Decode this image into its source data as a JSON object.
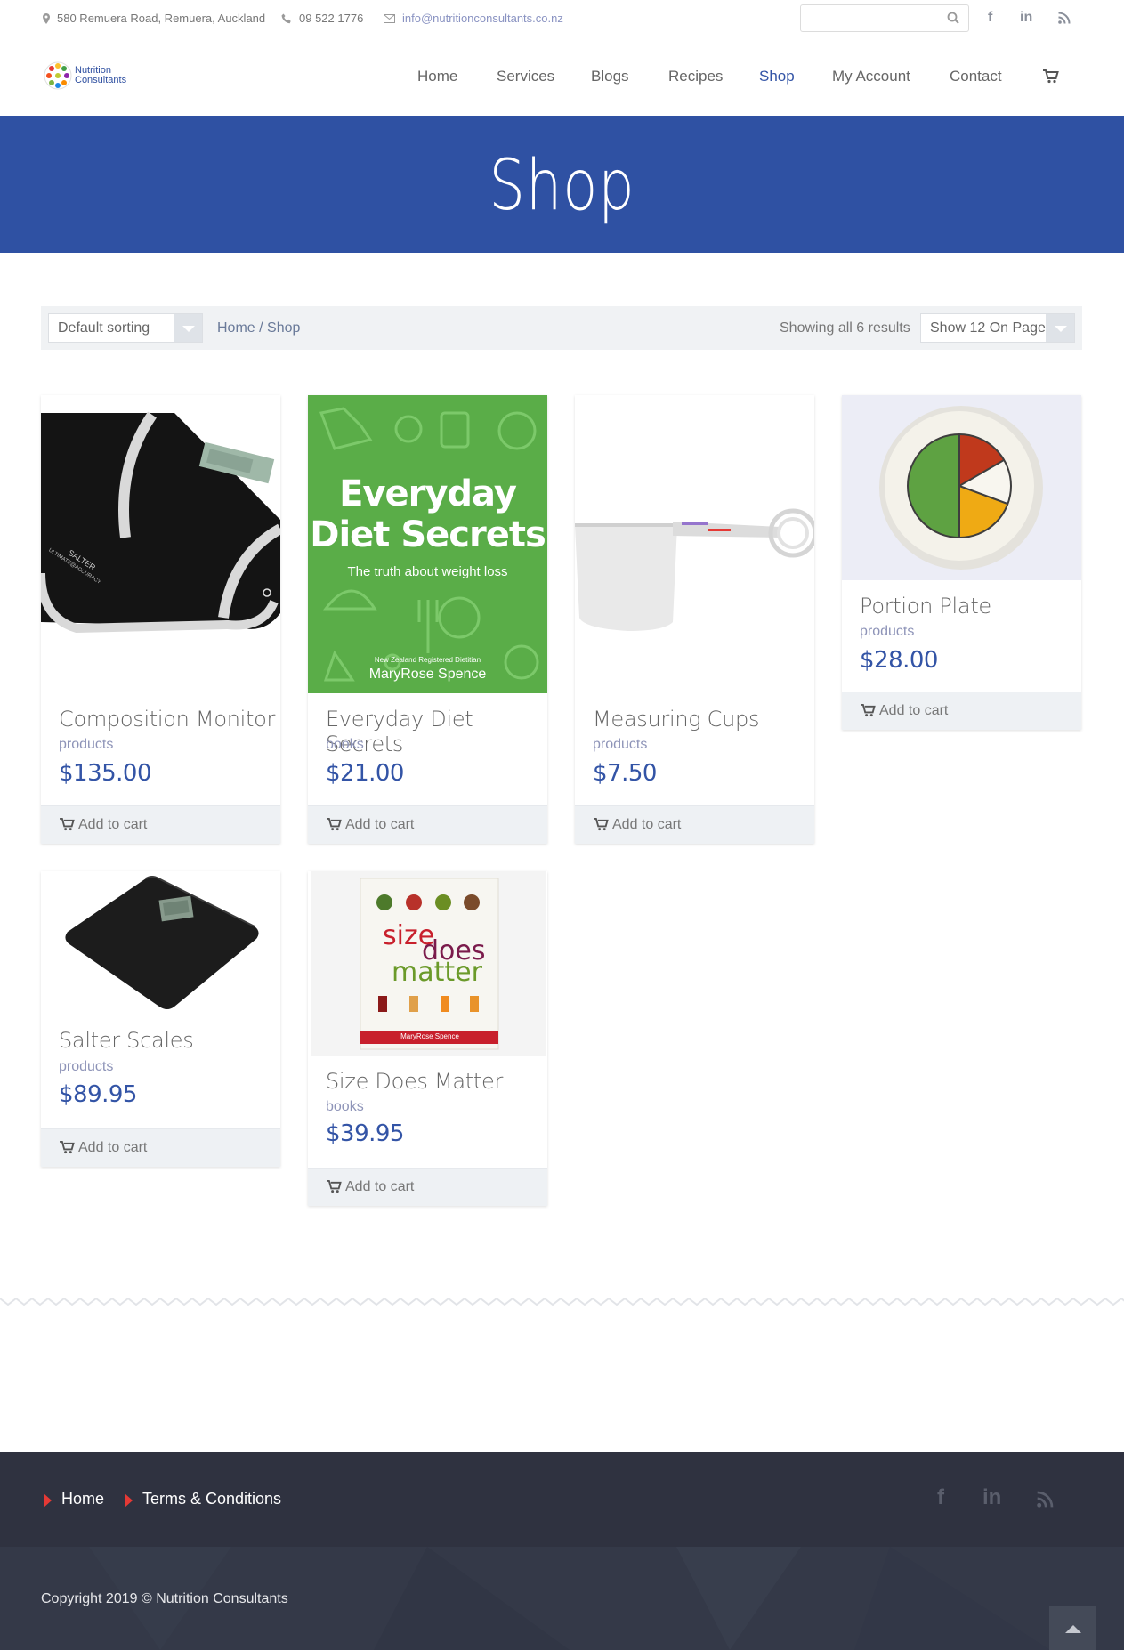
{
  "topbar": {
    "address": "580 Remuera Road, Remuera, Auckland",
    "phone": "09 522 1776",
    "email": "info@nutritionconsultants.co.nz",
    "search_placeholder": ""
  },
  "brand": {
    "line1": "Nutrition",
    "line2": "Consultants"
  },
  "nav": {
    "items": [
      {
        "label": "Home",
        "active": false
      },
      {
        "label": "Services",
        "active": false
      },
      {
        "label": "Blogs",
        "active": false
      },
      {
        "label": "Recipes",
        "active": false
      },
      {
        "label": "Shop",
        "active": true
      },
      {
        "label": "My Account",
        "active": false
      },
      {
        "label": "Contact",
        "active": false
      }
    ]
  },
  "hero": {
    "title": "Shop"
  },
  "toolbar": {
    "sorting_value": "Default sorting",
    "breadcrumb": "Home / Shop",
    "results": "Showing all 6 results",
    "per_page_value": "Show 12 On Page"
  },
  "products": [
    {
      "title": "Composition Monitor",
      "category": "products",
      "price": "$135.00",
      "cart_label": "Add to cart"
    },
    {
      "title": "Everyday Diet Secrets",
      "category": "books",
      "price": "$21.00",
      "cart_label": "Add to cart",
      "cover": {
        "line1": "Everyday",
        "line2": "Diet Secrets",
        "tagline": "The truth about weight loss",
        "small": "New Zealand Registered Dietitian",
        "author": "MaryRose Spence"
      }
    },
    {
      "title": "Measuring Cups",
      "category": "products",
      "price": "$7.50",
      "cart_label": "Add to cart"
    },
    {
      "title": "Portion Plate",
      "category": "products",
      "price": "$28.00",
      "cart_label": "Add to cart"
    },
    {
      "title": "Salter Scales",
      "category": "products",
      "price": "$89.95",
      "cart_label": "Add to cart"
    },
    {
      "title": "Size Does Matter",
      "category": "books",
      "price": "$39.95",
      "cart_label": "Add to cart",
      "cover": {
        "word1": "size",
        "word2": "does",
        "word3": "matter",
        "author": "MaryRose Spence"
      }
    }
  ],
  "footer": {
    "links": [
      "Home",
      "Terms & Conditions"
    ],
    "copyright": "Copyright 2019 © Nutrition Consultants"
  },
  "colors": {
    "brand_blue": "#2f51a3",
    "footer_dark": "#2f3240",
    "accent_red": "#e53935",
    "book_green": "#5aad48"
  }
}
